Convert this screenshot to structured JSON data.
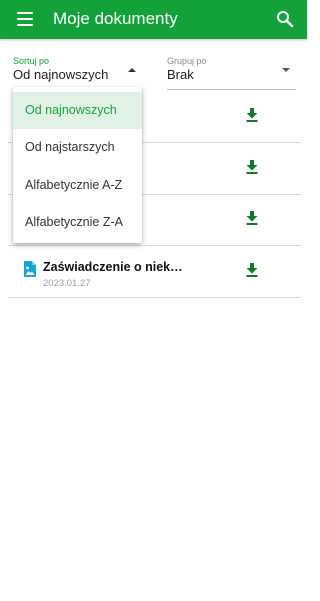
{
  "app_bar": {
    "title": "Moje dokumenty",
    "menu_icon": "hamburger-menu-icon",
    "search_icon": "search-icon",
    "color": "#13a23a"
  },
  "sort_field": {
    "label": "Sortuj po",
    "value": "Od najnowszych",
    "expanded": true
  },
  "group_field": {
    "label": "Grupuj po",
    "value": "Brak"
  },
  "sort_options": [
    {
      "label": "Od najnowszych",
      "selected": true
    },
    {
      "label": "Od najstarszych",
      "selected": false
    },
    {
      "label": "Alfabetycznie A-Z",
      "selected": false
    },
    {
      "label": "Alfabetycznie Z-A",
      "selected": false
    }
  ],
  "documents": [
    {
      "title": "",
      "date": ""
    },
    {
      "title": "",
      "date": ""
    },
    {
      "title": "",
      "date": ""
    },
    {
      "title": "Zaświadczenie o niek…",
      "date": "2023.01.27",
      "icon": "image-file-icon"
    }
  ],
  "download_icon": "download-icon"
}
